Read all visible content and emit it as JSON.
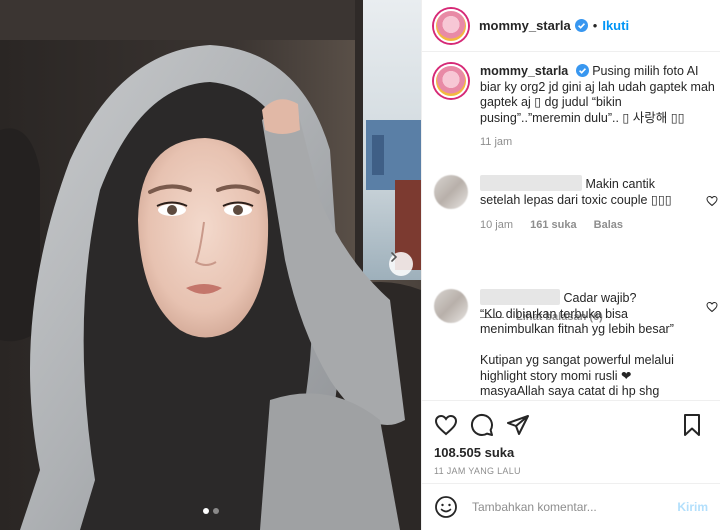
{
  "post": {
    "username": "mommy_starla",
    "separator": "•",
    "follow_label": "Ikuti",
    "caption": "Pusing milih foto AI biar ky org2 jd gini aj lah udah gaptek mah gaptek aj ▯ dg judul “bikin pusing”..”meremin dulu”.. ▯ 사랑해 ▯▯",
    "caption_time": "11 jam",
    "carousel": {
      "slides": 2,
      "active": 0
    }
  },
  "comments": [
    {
      "text": "Makin cantik setelah lepas dari toxic couple ▯▯▯",
      "time": "10 jam",
      "likes": "161 suka",
      "reply_label": "Balas",
      "view_replies": "Lihat balasan (6)"
    },
    {
      "text_line1": "Cadar wajib?",
      "text_line2": "“Klo dibiarkan terbuka bisa menimbulkan fitnah yg lebih besar”",
      "text_line3": "Kutipan yg sangat powerful melalui highlight story momi rusli ❤",
      "text_line4": "masyaAllah saya catat di hp shg"
    }
  ],
  "actions": {
    "likes_count": "108.505 suka",
    "timestamp": "11 JAM YANG LALU"
  },
  "comment_box": {
    "placeholder": "Tambahkan komentar...",
    "post_label": "Kirim"
  },
  "colors": {
    "link_blue": "#0095f6",
    "verified_blue": "#3897f0",
    "post_disabled": "#b2dffc",
    "muted_gray": "#8e8e8e"
  },
  "icons": [
    "chevron-right-icon",
    "verified-badge-icon",
    "heart-icon",
    "comment-icon",
    "share-icon",
    "bookmark-icon",
    "emoji-icon"
  ]
}
